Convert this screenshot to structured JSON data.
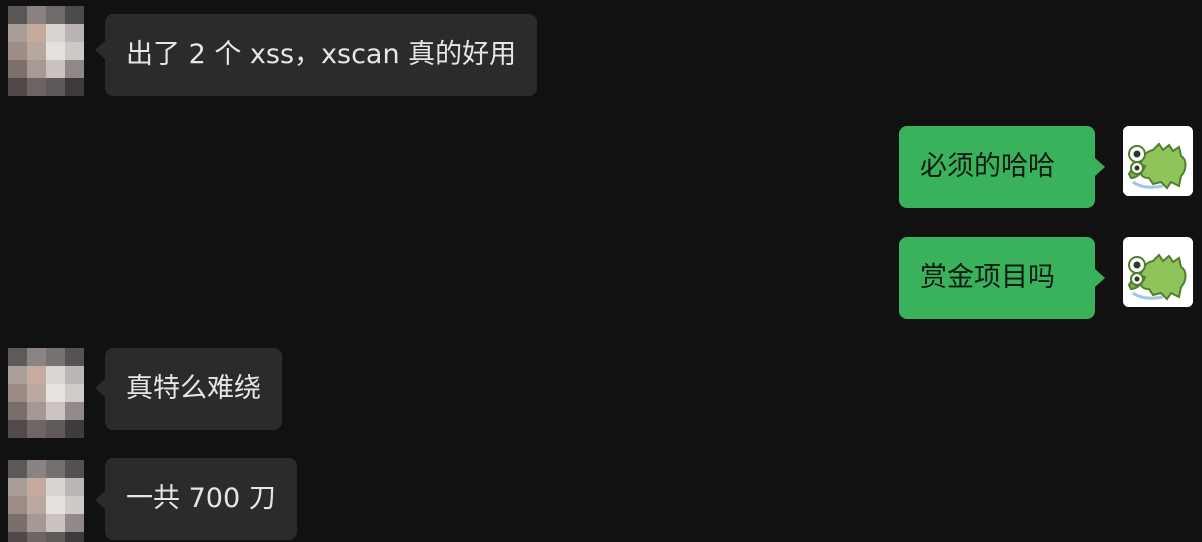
{
  "colors": {
    "background": "#111111",
    "incoming_bubble": "#2b2b2b",
    "outgoing_bubble": "#3ab25c",
    "incoming_text": "#e6e6e6",
    "outgoing_text": "#101a12"
  },
  "messages": [
    {
      "direction": "incoming",
      "avatar": "pixelated-avatar",
      "text": "出了 2 个 xss，xscan 真的好用"
    },
    {
      "direction": "outgoing",
      "avatar": "green-crocodile-sticker-avatar",
      "text": "必须的哈哈"
    },
    {
      "direction": "outgoing",
      "avatar": "green-crocodile-sticker-avatar",
      "text": "赏金项目吗"
    },
    {
      "direction": "incoming",
      "avatar": "pixelated-avatar",
      "text": "真特么难绕"
    },
    {
      "direction": "incoming",
      "avatar": "pixelated-avatar",
      "text": "一共 700 刀"
    }
  ]
}
